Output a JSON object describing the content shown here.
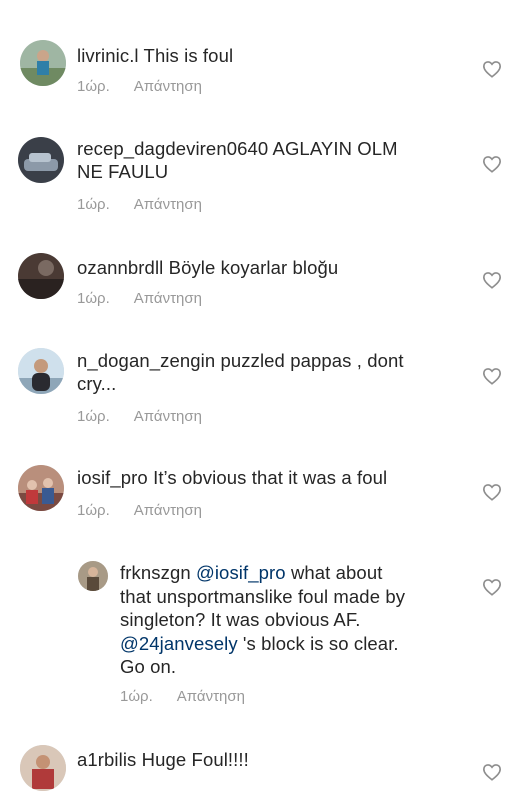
{
  "comments": [
    {
      "username": "livrinic.l",
      "text": "This is foul",
      "time": "1ώρ.",
      "reply": "Απάντηση"
    },
    {
      "username": "recep_dagdeviren0640",
      "text": "AGLAYIN OLM",
      "text2": "NE FAULU",
      "time": "1ώρ.",
      "reply": "Απάντηση"
    },
    {
      "username": "ozannbrdll",
      "text": "Böyle koyarlar bloğu",
      "time": "1ώρ.",
      "reply": "Απάντηση"
    },
    {
      "username": "n_dogan_zengin",
      "text": "puzzled pappas , dont",
      "text2": "cry...",
      "time": "1ώρ.",
      "reply": "Απάντηση"
    },
    {
      "username": "iosif_pro",
      "text": "It’s obvious that it was a foul",
      "time": "1ώρ.",
      "reply": "Απάντηση"
    },
    {
      "username": "frknszgn",
      "mention1": "@iosif_pro",
      "text": "what about",
      "line2": "that unsportmanslike foul made by",
      "line3": "singleton? It was obvious AF.",
      "mention2": "@24janvesely",
      "line4_rest": " 's block is so clear.",
      "line5": "Go on.",
      "time": "1ώρ.",
      "reply": "Απάντηση"
    },
    {
      "username": "a1rbilis",
      "text": "Huge Foul!!!!"
    }
  ],
  "icons": {
    "like": "heart-outline-icon"
  },
  "colors": {
    "text": "#262626",
    "meta": "#999999",
    "mention": "#003569"
  }
}
